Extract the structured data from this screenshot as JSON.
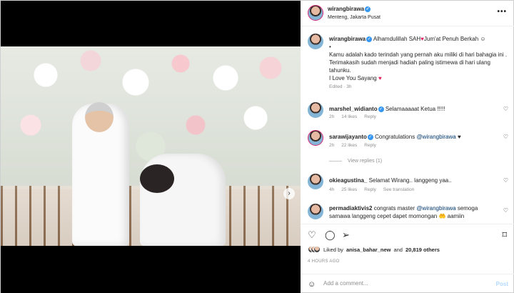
{
  "post": {
    "author": "wirangbirawa",
    "location": "Menteng, Jakarta Pusat"
  },
  "caption": {
    "username": "wirangbirawa",
    "line1": "Alhamdulillah SAH",
    "line1b": "Jum'at Penuh Berkah",
    "bullet": "•",
    "body": "Kamu adalah kado terindah yang pernah aku miliki di hari bahagia ini . Terimakasih sudah menjadi hadiah paling istimewa di hari ulang tahunku.",
    "closing": "I Love You Sayang",
    "meta": "Edited · 3h"
  },
  "comments": [
    {
      "username": "marshel_widianto",
      "text": "Selamaaaaat Ketua !!!!!",
      "time": "2h",
      "likes": "14 likes",
      "reply": "Reply"
    },
    {
      "username": "sarawijayanto",
      "text": "Congratulations",
      "mention": "@wirangbirawa",
      "suffix": "♥",
      "time": "2h",
      "likes": "22 likes",
      "reply": "Reply"
    },
    {
      "username": "okieagustina_",
      "text": "Selamat Wirang.. langgeng yaa..",
      "time": "4h",
      "likes": "25 likes",
      "reply": "Reply",
      "translate": "See translation"
    },
    {
      "username": "permadiaktivis2",
      "text": "congrats master",
      "mention": "@wirangbirawa",
      "suffix": "semoga samawa langgeng cepet dapet momongan 🤲 aamiin"
    }
  ],
  "view_replies": "View replies (1)",
  "likes": {
    "prefix": "Liked by",
    "user": "anisa_bahar_new",
    "joiner": "and",
    "count": "20,819 others"
  },
  "time_ago": "4 HOURS AGO",
  "add_comment": {
    "placeholder": "Add a comment...",
    "post_label": "Post"
  },
  "icons": {
    "more": "more-icon",
    "heart": "heart-icon",
    "comment": "comment-icon",
    "share": "share-icon",
    "save": "save-icon",
    "emoji": "emoji-icon",
    "verified": "verified-icon"
  },
  "colors": {
    "verified": "#3897f0",
    "mention": "#00376b",
    "muted": "#8e8e8e",
    "heart": "#e0245e",
    "post_button": "#b3dbff"
  },
  "carousel": {
    "slides": 5,
    "active": 1
  }
}
